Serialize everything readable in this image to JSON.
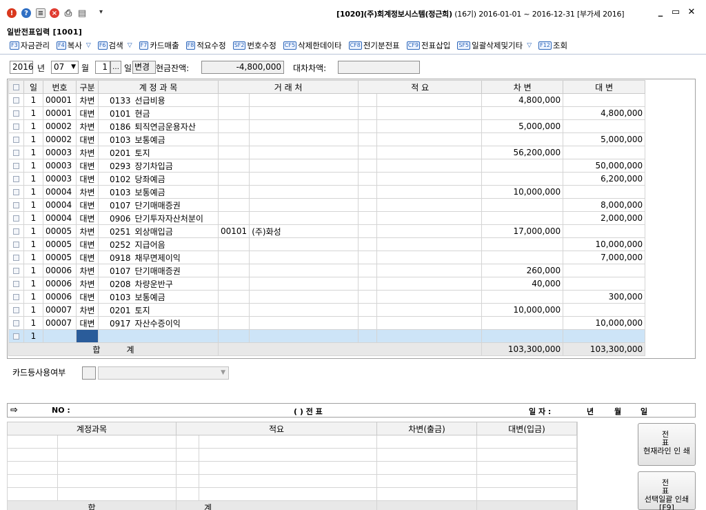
{
  "titlebar": {
    "title_code": "[1020](주)회계정보시스템(정근희)",
    "title_rest": "(16기) 2016-01-01 ~ 2016-12-31 [부가세 2016]",
    "icons": [
      "info-icon",
      "help-icon",
      "memo-icon",
      "close-circle-icon",
      "print-icon",
      "search-doc-icon"
    ]
  },
  "screen": {
    "caption": "일반전표입력 [1001]"
  },
  "fkeys": [
    {
      "key": "F3",
      "label": "자금관리",
      "dropdown": false
    },
    {
      "key": "F4",
      "label": "복사",
      "dropdown": true
    },
    {
      "key": "F6",
      "label": "검색",
      "dropdown": true
    },
    {
      "key": "F7",
      "label": "카드매출",
      "dropdown": false
    },
    {
      "key": "F8",
      "label": "적요수정",
      "dropdown": false
    },
    {
      "key": "SF2",
      "label": "번호수정",
      "dropdown": false
    },
    {
      "key": "CF5",
      "label": "삭제한데이타",
      "dropdown": false
    },
    {
      "key": "CF8",
      "label": "전기분전표",
      "dropdown": false
    },
    {
      "key": "CF9",
      "label": "전표삽입",
      "dropdown": false
    },
    {
      "key": "SF5",
      "label": "일괄삭제및기타",
      "dropdown": true
    },
    {
      "key": "F12",
      "label": "조회",
      "dropdown": false
    }
  ],
  "criteria": {
    "year": "2016",
    "year_label": "년",
    "month": "07",
    "month_label": "월",
    "day": "1",
    "day_label": "일",
    "change_btn": "변경",
    "cash_balance_label": "현금잔액:",
    "cash_balance": "-4,800,000",
    "diff_label": "대차차액:",
    "diff_value": ""
  },
  "grid": {
    "headers": [
      "",
      "일",
      "번호",
      "구분",
      "계 정 과 목",
      "거 래 처",
      "적 요",
      "차 변",
      "대 변"
    ],
    "rows": [
      {
        "day": "1",
        "no": "00001",
        "type": "차변",
        "code": "0133",
        "account": "선급비용",
        "vcode": "",
        "vendor": "",
        "memo_code": "",
        "memo": "",
        "debit": "4,800,000",
        "credit": ""
      },
      {
        "day": "1",
        "no": "00001",
        "type": "대변",
        "code": "0101",
        "account": "현금",
        "vcode": "",
        "vendor": "",
        "memo_code": "",
        "memo": "",
        "debit": "",
        "credit": "4,800,000"
      },
      {
        "day": "1",
        "no": "00002",
        "type": "차변",
        "code": "0186",
        "account": "퇴직연금운용자산",
        "vcode": "",
        "vendor": "",
        "memo_code": "",
        "memo": "",
        "debit": "5,000,000",
        "credit": ""
      },
      {
        "day": "1",
        "no": "00002",
        "type": "대변",
        "code": "0103",
        "account": "보통예금",
        "vcode": "",
        "vendor": "",
        "memo_code": "",
        "memo": "",
        "debit": "",
        "credit": "5,000,000"
      },
      {
        "day": "1",
        "no": "00003",
        "type": "차변",
        "code": "0201",
        "account": "토지",
        "vcode": "",
        "vendor": "",
        "memo_code": "",
        "memo": "",
        "debit": "56,200,000",
        "credit": ""
      },
      {
        "day": "1",
        "no": "00003",
        "type": "대변",
        "code": "0293",
        "account": "장기차입금",
        "vcode": "",
        "vendor": "",
        "memo_code": "",
        "memo": "",
        "debit": "",
        "credit": "50,000,000"
      },
      {
        "day": "1",
        "no": "00003",
        "type": "대변",
        "code": "0102",
        "account": "당좌예금",
        "vcode": "",
        "vendor": "",
        "memo_code": "",
        "memo": "",
        "debit": "",
        "credit": "6,200,000"
      },
      {
        "day": "1",
        "no": "00004",
        "type": "차변",
        "code": "0103",
        "account": "보통예금",
        "vcode": "",
        "vendor": "",
        "memo_code": "",
        "memo": "",
        "debit": "10,000,000",
        "credit": ""
      },
      {
        "day": "1",
        "no": "00004",
        "type": "대변",
        "code": "0107",
        "account": "단기매매증권",
        "vcode": "",
        "vendor": "",
        "memo_code": "",
        "memo": "",
        "debit": "",
        "credit": "8,000,000"
      },
      {
        "day": "1",
        "no": "00004",
        "type": "대변",
        "code": "0906",
        "account": "단기투자자산처분이",
        "vcode": "",
        "vendor": "",
        "memo_code": "",
        "memo": "",
        "debit": "",
        "credit": "2,000,000"
      },
      {
        "day": "1",
        "no": "00005",
        "type": "차변",
        "code": "0251",
        "account": "외상매입금",
        "vcode": "00101",
        "vendor": "(주)화성",
        "memo_code": "",
        "memo": "",
        "debit": "17,000,000",
        "credit": ""
      },
      {
        "day": "1",
        "no": "00005",
        "type": "대변",
        "code": "0252",
        "account": "지급어음",
        "vcode": "",
        "vendor": "",
        "memo_code": "",
        "memo": "",
        "debit": "",
        "credit": "10,000,000"
      },
      {
        "day": "1",
        "no": "00005",
        "type": "대변",
        "code": "0918",
        "account": "채무면제이익",
        "vcode": "",
        "vendor": "",
        "memo_code": "",
        "memo": "",
        "debit": "",
        "credit": "7,000,000"
      },
      {
        "day": "1",
        "no": "00006",
        "type": "차변",
        "code": "0107",
        "account": "단기매매증권",
        "vcode": "",
        "vendor": "",
        "memo_code": "",
        "memo": "",
        "debit": "260,000",
        "credit": ""
      },
      {
        "day": "1",
        "no": "00006",
        "type": "차변",
        "code": "0208",
        "account": "차량운반구",
        "vcode": "",
        "vendor": "",
        "memo_code": "",
        "memo": "",
        "debit": "40,000",
        "credit": ""
      },
      {
        "day": "1",
        "no": "00006",
        "type": "대변",
        "code": "0103",
        "account": "보통예금",
        "vcode": "",
        "vendor": "",
        "memo_code": "",
        "memo": "",
        "debit": "",
        "credit": "300,000"
      },
      {
        "day": "1",
        "no": "00007",
        "type": "차변",
        "code": "0201",
        "account": "토지",
        "vcode": "",
        "vendor": "",
        "memo_code": "",
        "memo": "",
        "debit": "10,000,000",
        "credit": ""
      },
      {
        "day": "1",
        "no": "00007",
        "type": "대변",
        "code": "0917",
        "account": "자산수증이익",
        "vcode": "",
        "vendor": "",
        "memo_code": "",
        "memo": "",
        "debit": "",
        "credit": "10,000,000"
      }
    ],
    "new_row_day": "1",
    "total_label": "합          계",
    "total_debit": "103,300,000",
    "total_credit": "103,300,000"
  },
  "card": {
    "label": "카드등사용여부"
  },
  "slip": {
    "no_label": "NO :",
    "type_label": "(          ) 전   표",
    "date_label": "일 자 :",
    "year_label": "년",
    "month_label": "월",
    "day_label": "일",
    "headers": [
      "계정과목",
      "적요",
      "차변(출금)",
      "대변(입금)"
    ],
    "total_label_a": "합",
    "total_label_b": "계"
  },
  "side_buttons": {
    "btn1_top": "전 표",
    "btn1_bottom": "현재라인 인 쇄",
    "btn2_top": "전 표",
    "btn2_bottom": "선택일괄 인쇄[F9]"
  }
}
